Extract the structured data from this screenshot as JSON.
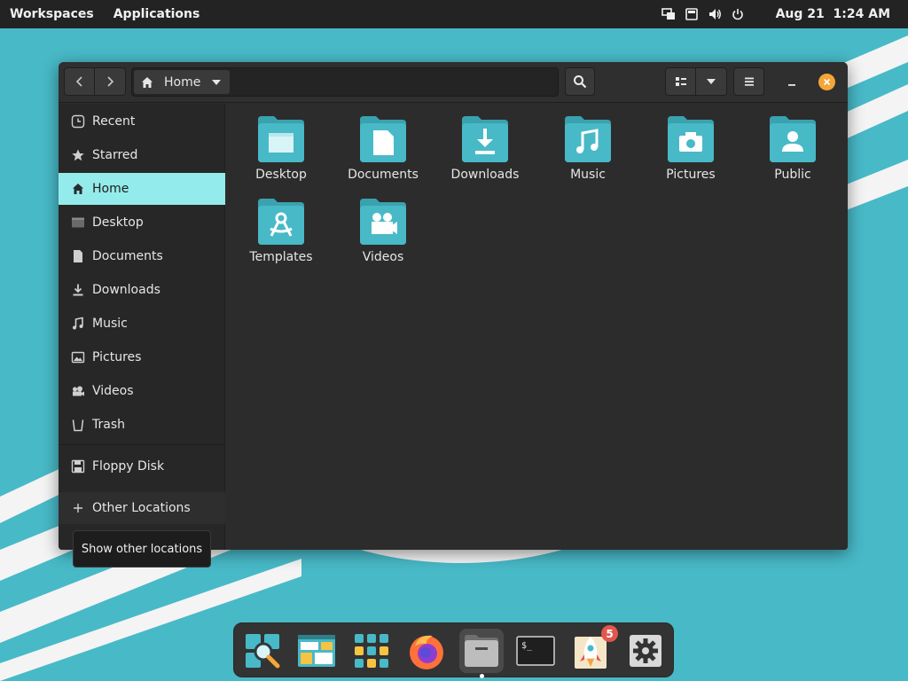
{
  "top_panel": {
    "workspaces_label": "Workspaces",
    "applications_label": "Applications",
    "date": "Aug 21",
    "time": "1:24 AM",
    "tray_icons": [
      "display-icon",
      "keyboard-icon",
      "volume-icon",
      "power-icon"
    ]
  },
  "window": {
    "location": {
      "path_label": "Home",
      "icon": "home-icon"
    },
    "toolbar": {
      "back_icon": "chevron-left-icon",
      "forward_icon": "chevron-right-icon",
      "search_icon": "search-icon",
      "view_icon": "list-view-icon",
      "view_dropdown_icon": "chevron-down-icon",
      "menu_icon": "hamburger-menu-icon",
      "minimize_icon": "minimize-icon",
      "close_icon": "close-icon"
    },
    "sidebar": {
      "items": [
        {
          "label": "Recent",
          "icon": "clock-icon",
          "active": false
        },
        {
          "label": "Starred",
          "icon": "star-icon",
          "active": false
        },
        {
          "label": "Home",
          "icon": "home-icon",
          "active": true
        },
        {
          "label": "Desktop",
          "icon": "desktop-icon",
          "active": false
        },
        {
          "label": "Documents",
          "icon": "document-icon",
          "active": false
        },
        {
          "label": "Downloads",
          "icon": "download-icon",
          "active": false
        },
        {
          "label": "Music",
          "icon": "music-icon",
          "active": false
        },
        {
          "label": "Pictures",
          "icon": "pictures-icon",
          "active": false
        },
        {
          "label": "Videos",
          "icon": "videos-icon",
          "active": false
        },
        {
          "label": "Trash",
          "icon": "trash-icon",
          "active": false
        },
        {
          "label": "Floppy Disk",
          "icon": "floppy-icon",
          "active": false
        },
        {
          "label": "Other Locations",
          "icon": "plus-icon",
          "active": false
        }
      ]
    },
    "files": [
      {
        "name": "Desktop",
        "emblem": "desktop-emblem-icon"
      },
      {
        "name": "Documents",
        "emblem": "document-emblem-icon"
      },
      {
        "name": "Downloads",
        "emblem": "download-emblem-icon"
      },
      {
        "name": "Music",
        "emblem": "music-emblem-icon"
      },
      {
        "name": "Pictures",
        "emblem": "camera-emblem-icon"
      },
      {
        "name": "Public",
        "emblem": "person-emblem-icon"
      },
      {
        "name": "Templates",
        "emblem": "templates-emblem-icon"
      },
      {
        "name": "Videos",
        "emblem": "video-camera-emblem-icon"
      }
    ],
    "tooltip": "Show other locations"
  },
  "dock": {
    "apps": [
      {
        "name": "Files search",
        "icon": "magnifier-app-icon"
      },
      {
        "name": "Workspaces",
        "icon": "workspaces-app-icon"
      },
      {
        "name": "App grid",
        "icon": "app-grid-icon"
      },
      {
        "name": "Firefox",
        "icon": "firefox-icon"
      },
      {
        "name": "Files",
        "icon": "files-app-icon",
        "active": true
      },
      {
        "name": "Terminal",
        "icon": "terminal-icon"
      },
      {
        "name": "Pop Shop",
        "icon": "pop-shop-icon",
        "badge": "5"
      },
      {
        "name": "Settings",
        "icon": "settings-gear-icon"
      }
    ]
  },
  "colors": {
    "desktop_bg": "#48b9c7",
    "panel_bg": "#232323",
    "window_bg": "#2c2c2c",
    "sidebar_active": "#94ebeb",
    "folder": "#48b9c7",
    "close_button": "#f4a636",
    "badge": "#e2574c"
  }
}
